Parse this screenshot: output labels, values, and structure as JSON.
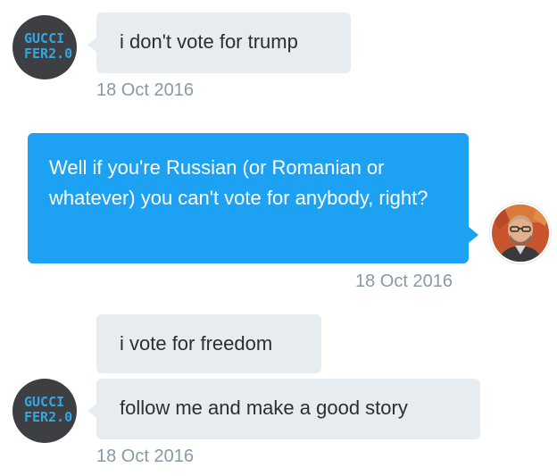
{
  "conversation": {
    "messages": [
      {
        "sender": "Guccifer 2.0",
        "direction": "incoming",
        "text": "i don't vote for trump",
        "timestamp": "18 Oct 2016"
      },
      {
        "direction": "outgoing",
        "text": "Well if you're Russian (or Romanian or whatever) you can't vote for anybody, right?",
        "timestamp": "18 Oct 2016"
      },
      {
        "sender": "Guccifer 2.0",
        "direction": "incoming",
        "text": "i vote for freedom"
      },
      {
        "sender": "Guccifer 2.0",
        "direction": "incoming",
        "text": "follow me and make a good story",
        "timestamp": "18 Oct 2016"
      }
    ],
    "avatars": {
      "guccifer_logo_line1": "GUCCI",
      "guccifer_logo_line2": "FER2.0"
    }
  },
  "colors": {
    "incoming_bubble": "#e6ecf0",
    "outgoing_bubble": "#1da1f2",
    "timestamp": "#8899a6",
    "text": "#292f33"
  }
}
